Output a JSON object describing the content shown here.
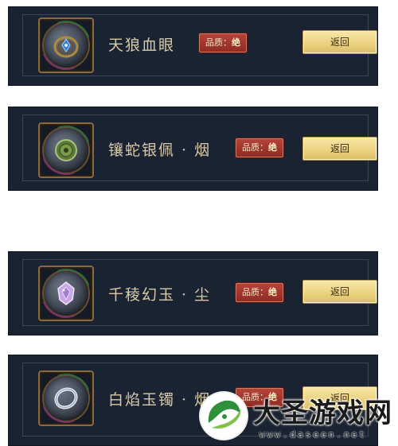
{
  "items": [
    {
      "name": "天狼血眼",
      "quality_label": "品质：",
      "quality_value": "绝",
      "button": "返回",
      "icon": "ring-gem-icon"
    },
    {
      "name": "镶蛇银佩 · 烟",
      "quality_label": "品质：",
      "quality_value": "绝",
      "button": "返回",
      "icon": "jade-pendant-icon"
    },
    {
      "name": "千稜幻玉 · 尘",
      "quality_label": "品质：",
      "quality_value": "绝",
      "button": "返回",
      "icon": "crystal-jade-icon"
    },
    {
      "name": "白焰玉镯 · 烟",
      "quality_label": "品质：",
      "quality_value": "绝",
      "button": "返回",
      "icon": "bracelet-icon"
    }
  ],
  "watermark": {
    "title": "大圣游戏网",
    "url": "www.daseen.net"
  },
  "colors": {
    "card_bg": "#1a2332",
    "quality_red": "#a63a32",
    "button_gold": "#ecd382",
    "name_text": "#d9c9a6"
  }
}
